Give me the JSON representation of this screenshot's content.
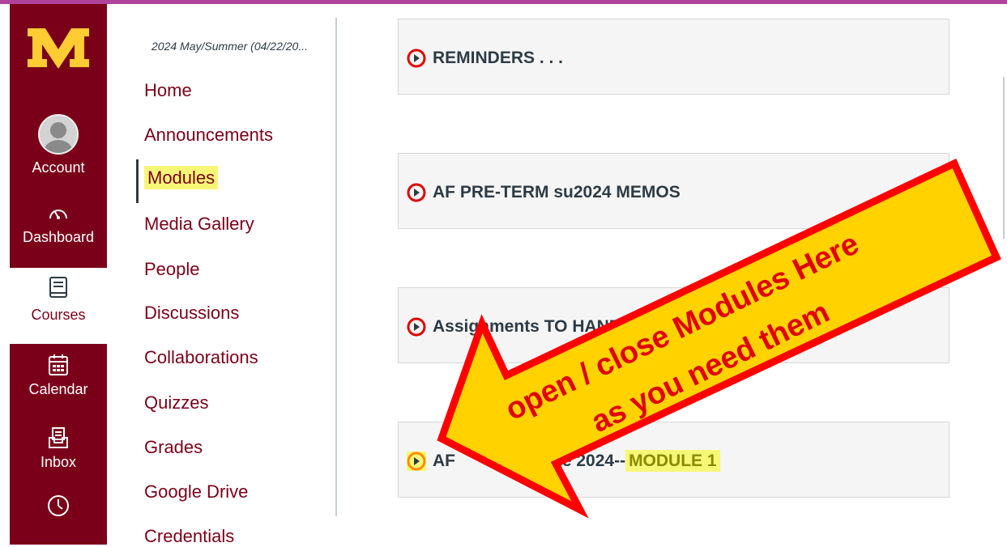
{
  "global_nav": {
    "logo_alt": "M",
    "items": [
      {
        "label": "Account",
        "icon": "account-avatar-icon"
      },
      {
        "label": "Dashboard",
        "icon": "dashboard-icon"
      },
      {
        "label": "Courses",
        "icon": "courses-icon"
      },
      {
        "label": "Calendar",
        "icon": "calendar-icon"
      },
      {
        "label": "Inbox",
        "icon": "inbox-icon"
      },
      {
        "label": "",
        "icon": "history-clock-icon"
      }
    ],
    "active": "Courses"
  },
  "course_nav": {
    "term": "2024 May/Summer (04/22/20...",
    "items": [
      "Home",
      "Announcements",
      "Modules",
      "Media Gallery",
      "People",
      "Discussions",
      "Collaborations",
      "Quizzes",
      "Grades",
      "Google Drive",
      "Credentials"
    ],
    "active": "Modules"
  },
  "modules": [
    {
      "title": "REMINDERS . . ."
    },
    {
      "title": "AF PRE-TERM su2024 MEMOS"
    },
    {
      "title": "Assignments TO HAND IN LINE th..."
    },
    {
      "title_prefix": "AF",
      "title_mid": "-8 June 2024--",
      "title_highlight": "MODULE 1"
    }
  ],
  "annotation": {
    "line1": "open / close Modules Here",
    "line2": "as you need them"
  },
  "colors": {
    "maroon": "#7a0019",
    "gold": "#ffcc33",
    "arrow_fill": "#ffd200",
    "arrow_stroke": "#ff0000"
  }
}
